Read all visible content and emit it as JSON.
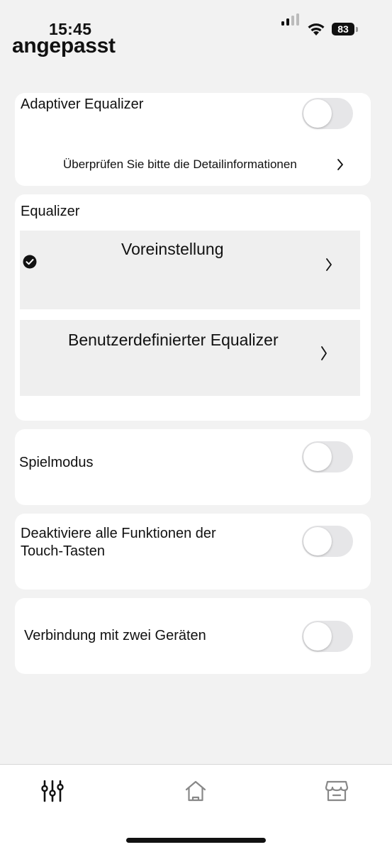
{
  "status": {
    "time": "15:45",
    "battery": "83"
  },
  "page": {
    "title": "angepasst"
  },
  "adaptive_eq": {
    "label": "Adaptiver Equalizer",
    "detail_link": "Überprüfen Sie bitte die Detailinformationen",
    "enabled": false
  },
  "equalizer": {
    "label": "Equalizer",
    "preset_label": "Voreinstellung",
    "custom_label": "Benutzerdefinierter Equalizer",
    "selected": "preset"
  },
  "game_mode": {
    "label": "Spielmodus",
    "enabled": false
  },
  "touch_controls": {
    "label_line1": "Deaktiviere alle Funktionen der",
    "label_line2": "Touch-Tasten",
    "enabled": false
  },
  "dual_connection": {
    "label": "Verbindung mit zwei Geräten",
    "enabled": false
  },
  "tabbar": {
    "items": [
      "equalizer-settings",
      "home",
      "store"
    ],
    "active": "equalizer-settings"
  }
}
